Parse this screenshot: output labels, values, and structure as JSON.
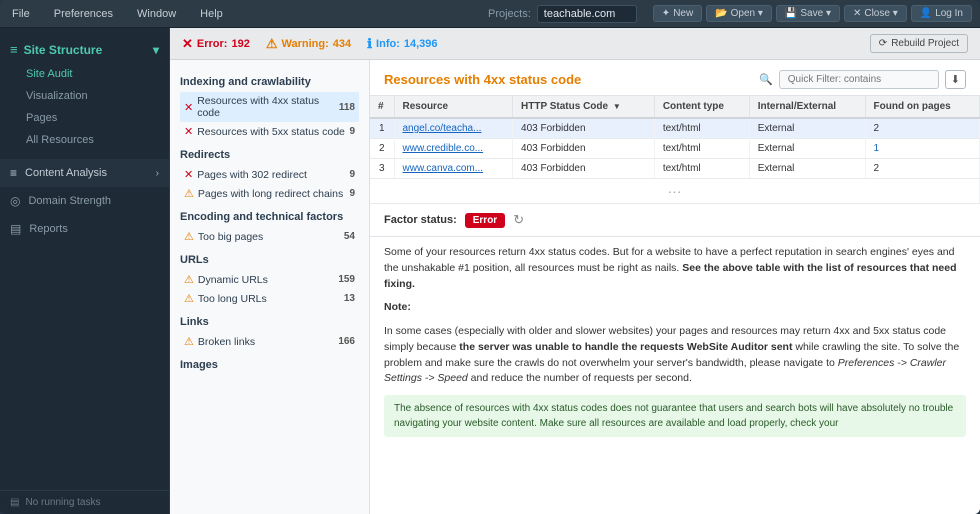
{
  "menu": {
    "items": [
      "File",
      "Preferences",
      "Window",
      "Help"
    ]
  },
  "projects": {
    "label": "Projects:",
    "current": "teachable.com"
  },
  "toolbar_buttons": [
    {
      "label": "New",
      "icon": "✦"
    },
    {
      "label": "Open",
      "icon": "📂"
    },
    {
      "label": "Save",
      "icon": "💾"
    },
    {
      "label": "Close",
      "icon": "✕"
    },
    {
      "label": "Log In",
      "icon": "👤"
    }
  ],
  "status_bar": {
    "error_icon": "✕",
    "error_label": "Error:",
    "error_count": "192",
    "warning_icon": "⚠",
    "warning_label": "Warning:",
    "warning_count": "434",
    "info_icon": "ℹ",
    "info_label": "Info:",
    "info_count": "14,396",
    "rebuild_label": "Rebuild Project"
  },
  "sidebar": {
    "section_title": "Site Structure",
    "nav_items": [
      "Site Audit",
      "Visualization",
      "Pages",
      "All Resources"
    ],
    "active_nav": "Site Audit",
    "sections": [
      {
        "label": "Content Analysis",
        "icon": "≡"
      },
      {
        "label": "Domain Strength",
        "icon": "◎"
      },
      {
        "label": "Reports",
        "icon": "▤"
      }
    ],
    "bottom_label": "No running tasks"
  },
  "audit": {
    "sections": [
      {
        "title": "Indexing and crawlability",
        "items": [
          {
            "icon": "error",
            "label": "Resources with 4xx status code",
            "count": "118",
            "selected": true
          },
          {
            "icon": "error",
            "label": "Resources with 5xx status code",
            "count": "9",
            "selected": false
          }
        ]
      },
      {
        "title": "Redirects",
        "items": [
          {
            "icon": "error",
            "label": "Pages with 302 redirect",
            "count": "9",
            "selected": false
          },
          {
            "icon": "warning",
            "label": "Pages with long redirect chains",
            "count": "9",
            "selected": false
          }
        ]
      },
      {
        "title": "Encoding and technical factors",
        "items": [
          {
            "icon": "warning",
            "label": "Too big pages",
            "count": "54",
            "selected": false
          }
        ]
      },
      {
        "title": "URLs",
        "items": [
          {
            "icon": "warning",
            "label": "Dynamic URLs",
            "count": "159",
            "selected": false
          },
          {
            "icon": "warning",
            "label": "Too long URLs",
            "count": "13",
            "selected": false
          }
        ]
      },
      {
        "title": "Links",
        "items": [
          {
            "icon": "warning",
            "label": "Broken links",
            "count": "166",
            "selected": false
          }
        ]
      },
      {
        "title": "Images",
        "items": []
      }
    ]
  },
  "resource_panel": {
    "title": "Resources with 4xx status code",
    "filter_placeholder": "Quick Filter: contains",
    "columns": [
      "#",
      "Resource",
      "HTTP Status Code",
      "Content type",
      "Internal/External",
      "Found on pages"
    ],
    "rows": [
      {
        "num": "1",
        "resource": "angel.co/teacha...",
        "status": "403 Forbidden",
        "content_type": "text/html",
        "internal_external": "External",
        "found_on": "2"
      },
      {
        "num": "2",
        "resource": "www.credible.co...",
        "status": "403 Forbidden",
        "content_type": "text/html",
        "internal_external": "External",
        "found_on": "1"
      },
      {
        "num": "3",
        "resource": "www.canva.com...",
        "status": "403 Forbidden",
        "content_type": "text/html",
        "internal_external": "External",
        "found_on": "2"
      }
    ]
  },
  "factor_status": {
    "label": "Factor status:",
    "status": "Error"
  },
  "description": {
    "main_text": "Some of your resources return 4xx status codes. But for a website to have a perfect reputation in search engines' eyes and the unshakable #1 position, all resources must be right as nails.",
    "bold_part": "See the above table with the list of resources that need fixing.",
    "note_label": "Note:",
    "note_text": "In some cases (especially with older and slower websites) your pages and resources may return 4xx and 5xx status code simply because the server was unable to handle the requests WebSite Auditor sent while crawling the site. To solve the problem and make sure the crawls do not overwhelm your server's bandwidth, please navigate to Preferences -> Crawler Settings -> Speed and reduce the number of requests per second.",
    "green_note": "The absence of resources with 4xx status codes does not guarantee that users and search bots will have absolutely no trouble navigating your website content. Make sure all resources are available and load properly, check your"
  }
}
